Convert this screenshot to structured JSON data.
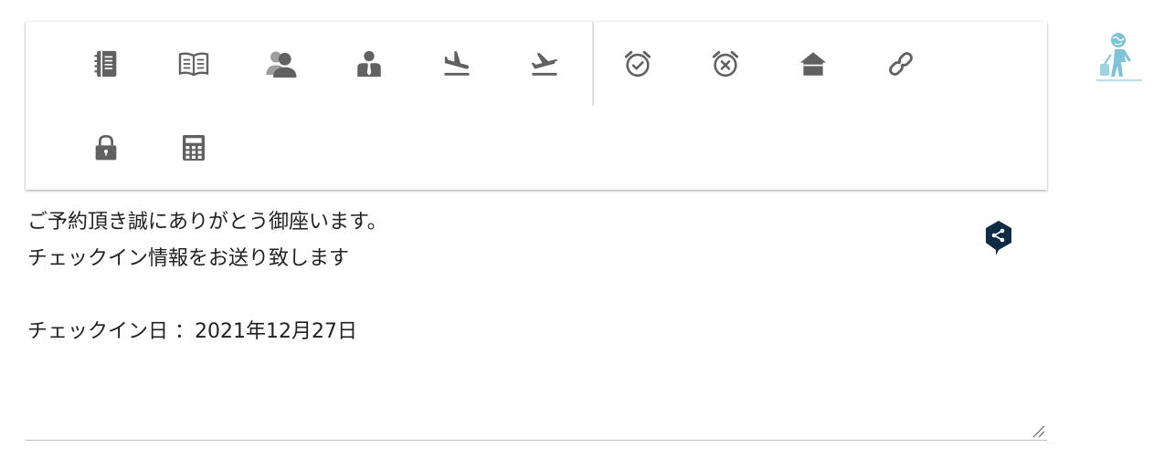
{
  "toolbar": {
    "row1_group1": [
      {
        "icon": "address-book-icon"
      },
      {
        "icon": "open-book-icon"
      },
      {
        "icon": "people-icon"
      },
      {
        "icon": "businessman-icon"
      },
      {
        "icon": "flight-arrival-icon"
      },
      {
        "icon": "flight-departure-icon"
      }
    ],
    "row1_group2": [
      {
        "icon": "alarm-check-icon"
      },
      {
        "icon": "alarm-cancel-icon"
      },
      {
        "icon": "home-icon"
      },
      {
        "icon": "link-icon"
      }
    ],
    "row2": [
      {
        "icon": "lock-icon"
      },
      {
        "icon": "calculator-icon"
      }
    ],
    "icon_color": "#616161"
  },
  "editor": {
    "lines": [
      "ご予約頂き誠にありがとう御座います。",
      "チェックイン情報をお送り致します",
      "",
      "チェックイン日 ：2021年12月27日"
    ],
    "text_color": "#212121"
  },
  "side": {
    "mascot_icon": "traveler-icon",
    "mascot_color": "#7ec3d8",
    "deepl_icon": "deepl-icon",
    "deepl_color": "#0f2b46"
  }
}
